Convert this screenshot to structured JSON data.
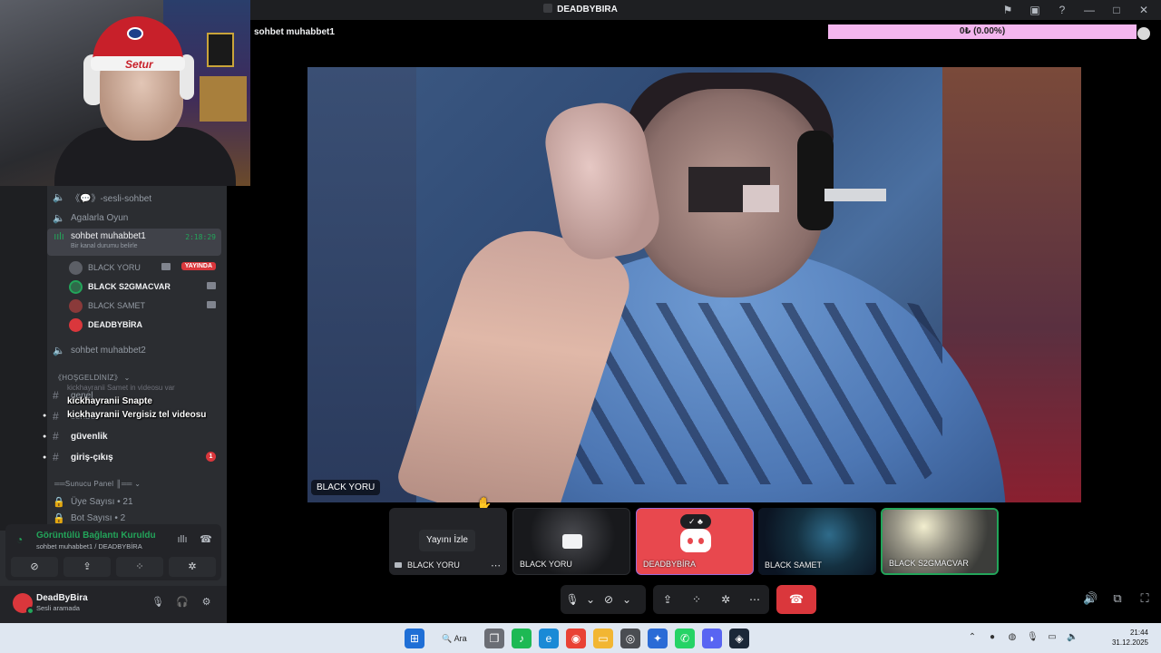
{
  "window": {
    "title": "DEADBYBIRA"
  },
  "webcam": {
    "hat_text": "Setur"
  },
  "sidebar": {
    "voice_channels": [
      {
        "label": "《💬》-sesli-sohbet"
      },
      {
        "label": "Agalarla Oyun"
      },
      {
        "label": "sohbet muhabbet1",
        "timer": "2:18:29",
        "status": "Bir kanal durumu belirle"
      },
      {
        "label": "sohbet muhabbet2"
      }
    ],
    "members": [
      {
        "name": "BLACK YORU",
        "badge": "YAYINDA"
      },
      {
        "name": "BLACK S2GMACVAR"
      },
      {
        "name": "BLACK SAMET"
      },
      {
        "name": "DEADBYBİRA"
      }
    ],
    "category": "《HOŞGELDİNİZ》",
    "text_channels": [
      {
        "label": "genel"
      },
      {
        "label": "sohbet"
      },
      {
        "label": "güvenlik"
      },
      {
        "label": "giriş-çıkış",
        "badge": "1"
      }
    ],
    "panel_category": "══Sunucu Panel ║══",
    "stats": [
      {
        "label": "Üye Sayısı • 21"
      },
      {
        "label": "Bot Sayısı • 2"
      }
    ]
  },
  "chat_overlay": {
    "ghost": "kickhayranii  Samet in videosu var",
    "lines": [
      {
        "nick": "kickhayranii",
        "text": "Snapte"
      },
      {
        "nick": "kickhayranii",
        "text": "Vergisiz tel videosu"
      }
    ]
  },
  "voice_panel": {
    "title": "Görüntülü Bağlantı Kuruldu",
    "subtitle": "sohbet muhabbet1 / DEADBYBİRA"
  },
  "user_panel": {
    "name": "DeadByBira",
    "status": "Sesli aramada"
  },
  "main": {
    "channel_title": "sohbet muhabbet1",
    "donation_text": "0₺ (0.00%)",
    "stage_label": "BLACK YORU"
  },
  "tiles": [
    {
      "name": "BLACK YORU",
      "watch_label": "Yayını İzle"
    },
    {
      "name": "BLACK YORU"
    },
    {
      "name": "DEADBYBİRA"
    },
    {
      "name": "BLACK SAMET"
    },
    {
      "name": "BLACK S2GMACVAR"
    }
  ],
  "taskbar": {
    "search_label": "Ara",
    "time": "21:44",
    "date": "31.12.2025"
  },
  "colors": {
    "online": "#23a55a",
    "danger": "#da373c",
    "sidebar_bg": "#2b2d31",
    "donation_bar": "#f4b6ef"
  }
}
